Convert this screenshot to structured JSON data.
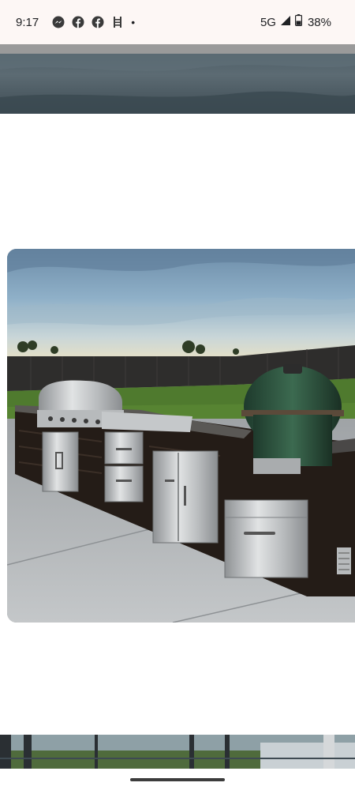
{
  "status_bar": {
    "time": "9:17",
    "notification_icons": [
      "messenger-icon",
      "facebook-icon",
      "facebook-icon",
      "ladder-icon"
    ],
    "overflow_dot": "•",
    "network": "5G",
    "battery": "38%"
  },
  "colors": {
    "status_bar_bg": "#fdf7f5",
    "page_bg": "#ffffff",
    "home_indicator": "#3c3c3c"
  }
}
